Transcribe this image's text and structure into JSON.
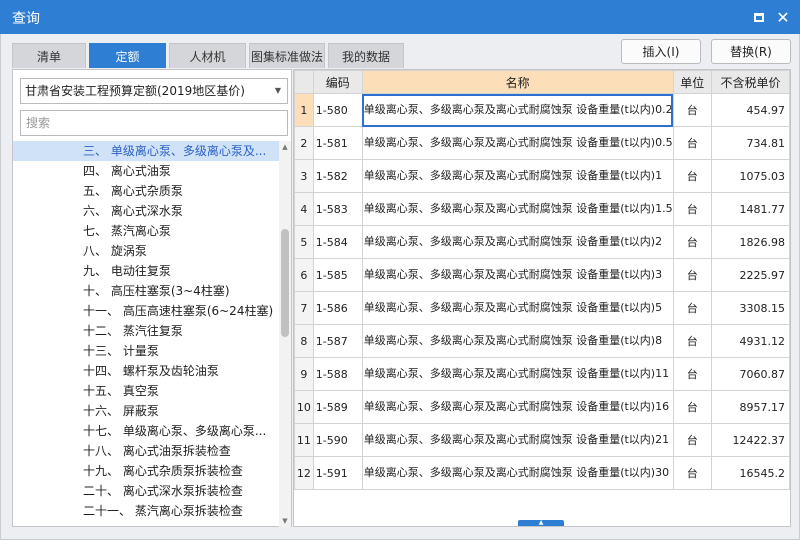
{
  "window": {
    "title": "查询",
    "maximize_icon": "maximize-icon",
    "close_icon": "close-icon",
    "close_glyph": "✕",
    "accent_color": "#2e7ed3"
  },
  "tabs": [
    {
      "label": "清单",
      "active": false
    },
    {
      "label": "定额",
      "active": true
    },
    {
      "label": "人材机",
      "active": false
    },
    {
      "label": "图集标准做法",
      "active": false
    },
    {
      "label": "我的数据",
      "active": false
    }
  ],
  "actions": {
    "insert_label": "插入(I)",
    "replace_label": "替换(R)"
  },
  "library_select": {
    "value": "甘肃省安装工程预算定额(2019地区基价)",
    "arrow_glyph": "▼"
  },
  "search": {
    "placeholder": "搜索",
    "value": ""
  },
  "tree": {
    "selected_index": 0,
    "items": [
      "三、 单级离心泵、多级离心泵及...",
      "四、 离心式油泵",
      "五、 离心式杂质泵",
      "六、 离心式深水泵",
      "七、 蒸汽离心泵",
      "八、 旋涡泵",
      "九、 电动往复泵",
      "十、 高压柱塞泵(3~4柱塞)",
      "十一、 高压高速柱塞泵(6~24柱塞)",
      "十二、 蒸汽往复泵",
      "十三、 计量泵",
      "十四、 螺杆泵及齿轮油泵",
      "十五、 真空泵",
      "十六、 屏蔽泵",
      "十七、 单级离心泵、多级离心泵...",
      "十八、 离心式油泵拆装检查",
      "十九、 离心式杂质泵拆装检查",
      "二十、 离心式深水泵拆装检查",
      "二十一、 蒸汽离心泵拆装检查"
    ],
    "scroll_up_glyph": "▲",
    "scroll_down_glyph": "▼"
  },
  "grid": {
    "columns": {
      "code": "编码",
      "name": "名称",
      "unit": "单位",
      "price": "不含税单价"
    },
    "current_row": 0,
    "rows": [
      {
        "num": "1",
        "code": "1-580",
        "name": "单级离心泵、多级离心泵及离心式耐腐蚀泵 设备重量(t以内)0.2",
        "unit": "台",
        "price": "454.97"
      },
      {
        "num": "2",
        "code": "1-581",
        "name": "单级离心泵、多级离心泵及离心式耐腐蚀泵 设备重量(t以内)0.5",
        "unit": "台",
        "price": "734.81"
      },
      {
        "num": "3",
        "code": "1-582",
        "name": "单级离心泵、多级离心泵及离心式耐腐蚀泵 设备重量(t以内)1",
        "unit": "台",
        "price": "1075.03"
      },
      {
        "num": "4",
        "code": "1-583",
        "name": "单级离心泵、多级离心泵及离心式耐腐蚀泵 设备重量(t以内)1.5",
        "unit": "台",
        "price": "1481.77"
      },
      {
        "num": "5",
        "code": "1-584",
        "name": "单级离心泵、多级离心泵及离心式耐腐蚀泵 设备重量(t以内)2",
        "unit": "台",
        "price": "1826.98"
      },
      {
        "num": "6",
        "code": "1-585",
        "name": "单级离心泵、多级离心泵及离心式耐腐蚀泵 设备重量(t以内)3",
        "unit": "台",
        "price": "2225.97"
      },
      {
        "num": "7",
        "code": "1-586",
        "name": "单级离心泵、多级离心泵及离心式耐腐蚀泵 设备重量(t以内)5",
        "unit": "台",
        "price": "3308.15"
      },
      {
        "num": "8",
        "code": "1-587",
        "name": "单级离心泵、多级离心泵及离心式耐腐蚀泵 设备重量(t以内)8",
        "unit": "台",
        "price": "4931.12"
      },
      {
        "num": "9",
        "code": "1-588",
        "name": "单级离心泵、多级离心泵及离心式耐腐蚀泵 设备重量(t以内)11",
        "unit": "台",
        "price": "7060.87"
      },
      {
        "num": "10",
        "code": "1-589",
        "name": "单级离心泵、多级离心泵及离心式耐腐蚀泵 设备重量(t以内)16",
        "unit": "台",
        "price": "8957.17"
      },
      {
        "num": "11",
        "code": "1-590",
        "name": "单级离心泵、多级离心泵及离心式耐腐蚀泵 设备重量(t以内)21",
        "unit": "台",
        "price": "12422.37"
      },
      {
        "num": "12",
        "code": "1-591",
        "name": "单级离心泵、多级离心泵及离心式耐腐蚀泵 设备重量(t以内)30",
        "unit": "台",
        "price": "16545.2"
      }
    ]
  },
  "splitter_glyph": "▲"
}
